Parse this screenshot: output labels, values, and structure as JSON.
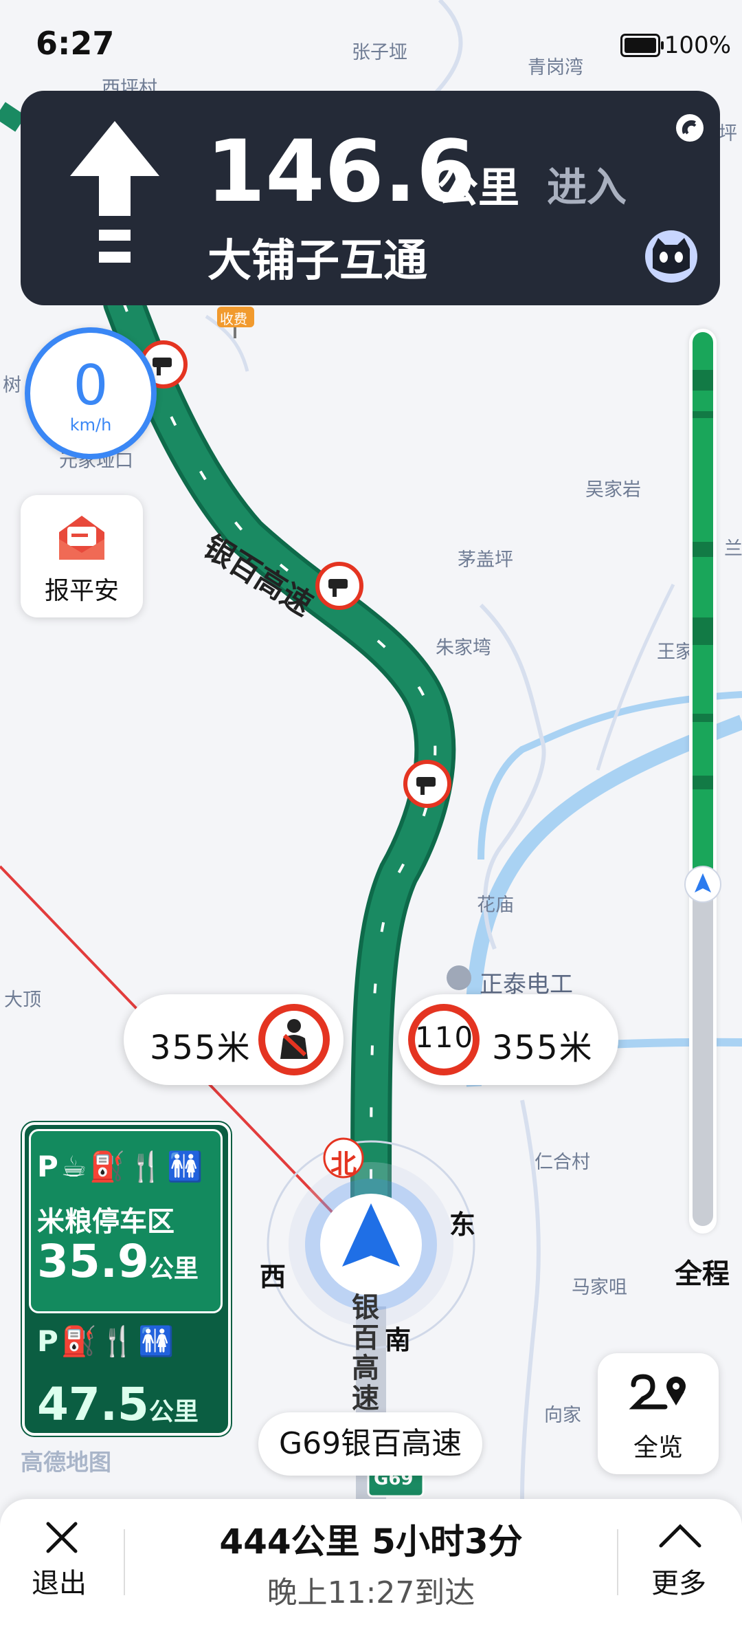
{
  "status_bar": {
    "time": "6:27",
    "battery": "100%"
  },
  "guidance": {
    "distance": "146.6",
    "unit": "公里",
    "action": "进入",
    "road": "大铺子互通"
  },
  "speed": {
    "value": "0",
    "unit": "km/h"
  },
  "safety_button": {
    "label": "报平安"
  },
  "progress": {
    "label": "全程",
    "fraction_travelled": 0.0
  },
  "alerts": {
    "left": {
      "distance": "355米",
      "sign": "seatbelt-icon"
    },
    "right": {
      "distance": "355米",
      "limit": "110"
    }
  },
  "services": {
    "first": {
      "name": "米粮停车区",
      "distance": "35.9",
      "unit": "公里",
      "icons": "P☕⛽🍴🚻"
    },
    "second": {
      "distance": "47.5",
      "unit": "公里",
      "icons": "P⛽🍴🚻"
    }
  },
  "map": {
    "places": [
      "张子垭",
      "西坪村",
      "青岗湾",
      "坪",
      "树",
      "元家垭口",
      "吴家岩",
      "茅盖坪",
      "朱家塆",
      "王家",
      "花庙",
      "正泰电工",
      "大顶",
      "仁合村",
      "马家咀",
      "向家",
      "兰"
    ],
    "toll_label": "收费",
    "road_name": "银百高速",
    "road_name_lower": "银百高速",
    "highway_shield": "G69",
    "compass": {
      "n": "北",
      "e": "东",
      "s": "南",
      "w": "西"
    },
    "watermark": "高德地图"
  },
  "current_road": {
    "label": "G69银百高速"
  },
  "overview_button": {
    "label": "全览"
  },
  "bottom_bar": {
    "exit_label": "退出",
    "summary": "444公里  5小时3分",
    "arrival": "晚上11:27到达",
    "more_label": "更多"
  },
  "colors": {
    "route": "#1a8a62",
    "banner": "#242a37",
    "accent": "#3a87f5",
    "alert_red": "#e43421"
  }
}
